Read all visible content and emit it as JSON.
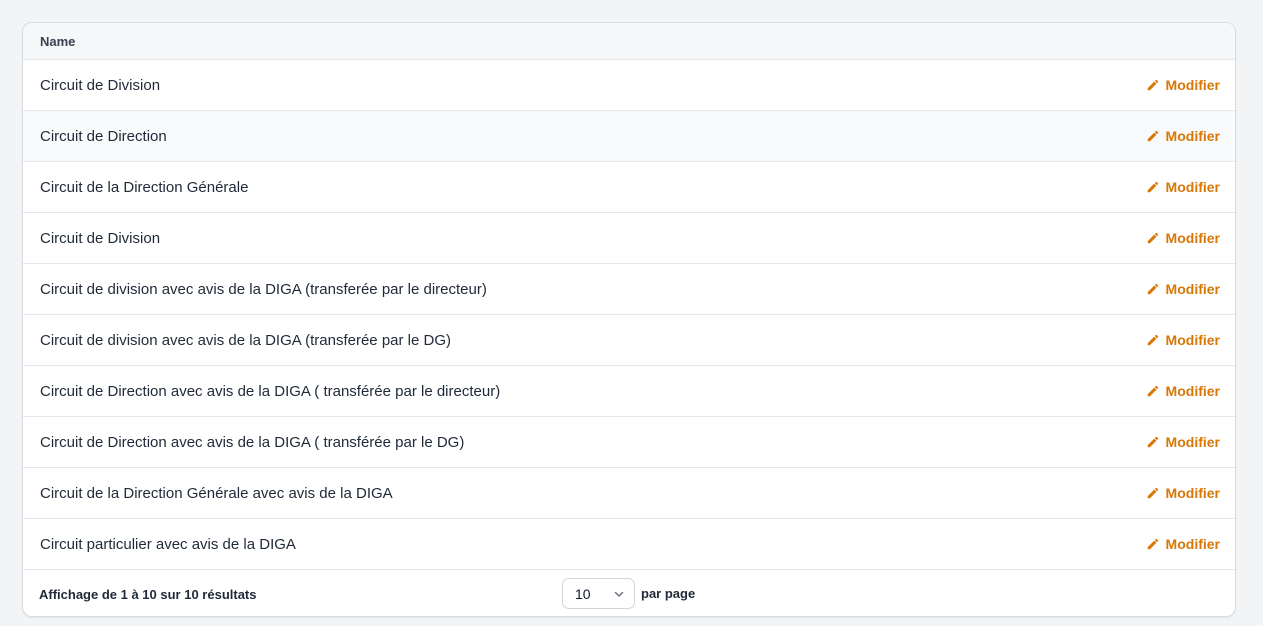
{
  "table": {
    "header": {
      "name_label": "Name"
    },
    "edit_label": "Modifier",
    "rows": [
      {
        "name": "Circuit de Division"
      },
      {
        "name": "Circuit de Direction"
      },
      {
        "name": "Circuit de la Direction Générale"
      },
      {
        "name": "Circuit de Division"
      },
      {
        "name": "Circuit de division avec avis de la DIGA (transferée par le directeur)"
      },
      {
        "name": "Circuit de division avec avis de la DIGA (transferée par le DG)"
      },
      {
        "name": "Circuit de Direction avec avis de la DIGA ( transférée par le directeur)"
      },
      {
        "name": "Circuit de Direction avec avis de la DIGA ( transférée par le DG)"
      },
      {
        "name": "Circuit de la Direction Générale avec avis de la DIGA"
      },
      {
        "name": "Circuit particulier avec avis de la DIGA"
      }
    ]
  },
  "pagination": {
    "info": "Affichage de 1 à 10 sur 10 résultats",
    "per_page_value": "10",
    "per_page_label": "par page"
  },
  "icons": {
    "edit": "pencil-icon",
    "select": "chevron-down-icon"
  },
  "colors": {
    "accent": "#d97706"
  }
}
